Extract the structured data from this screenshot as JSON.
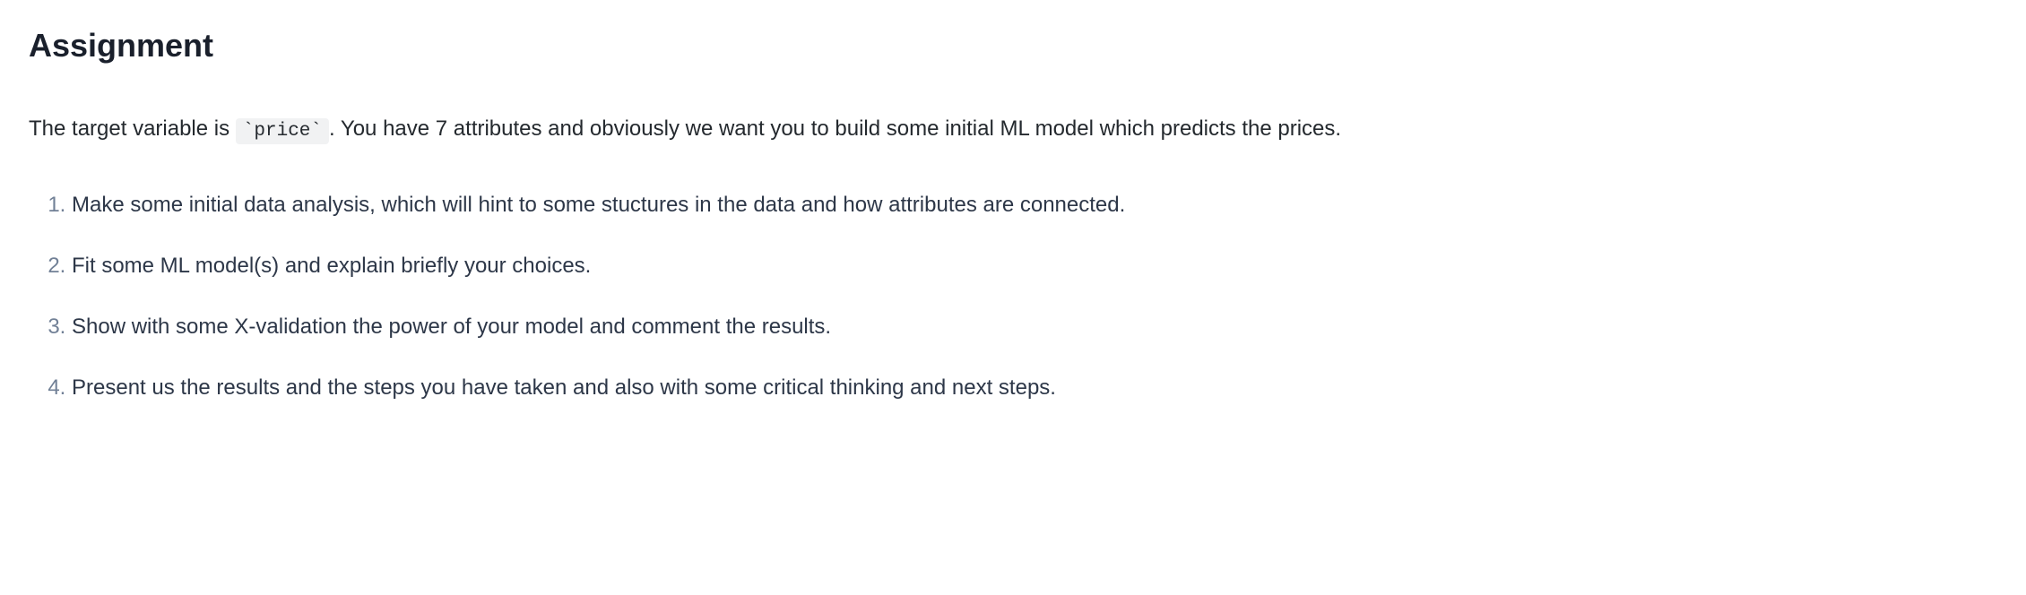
{
  "heading": "Assignment",
  "intro": {
    "before_code": "The target variable is ",
    "code": "`price`",
    "after_code": ". You have 7 attributes and obviously we want you to build some initial ML model which predicts the prices."
  },
  "list_items": [
    "Make some initial data analysis, which will hint to some stuctures in the data and how attributes are connected.",
    "Fit some ML model(s) and explain briefly your choices.",
    "Show with some X-validation the power of your model and comment the results.",
    "Present us the results and the steps you have taken and also with some critical thinking and next steps."
  ]
}
